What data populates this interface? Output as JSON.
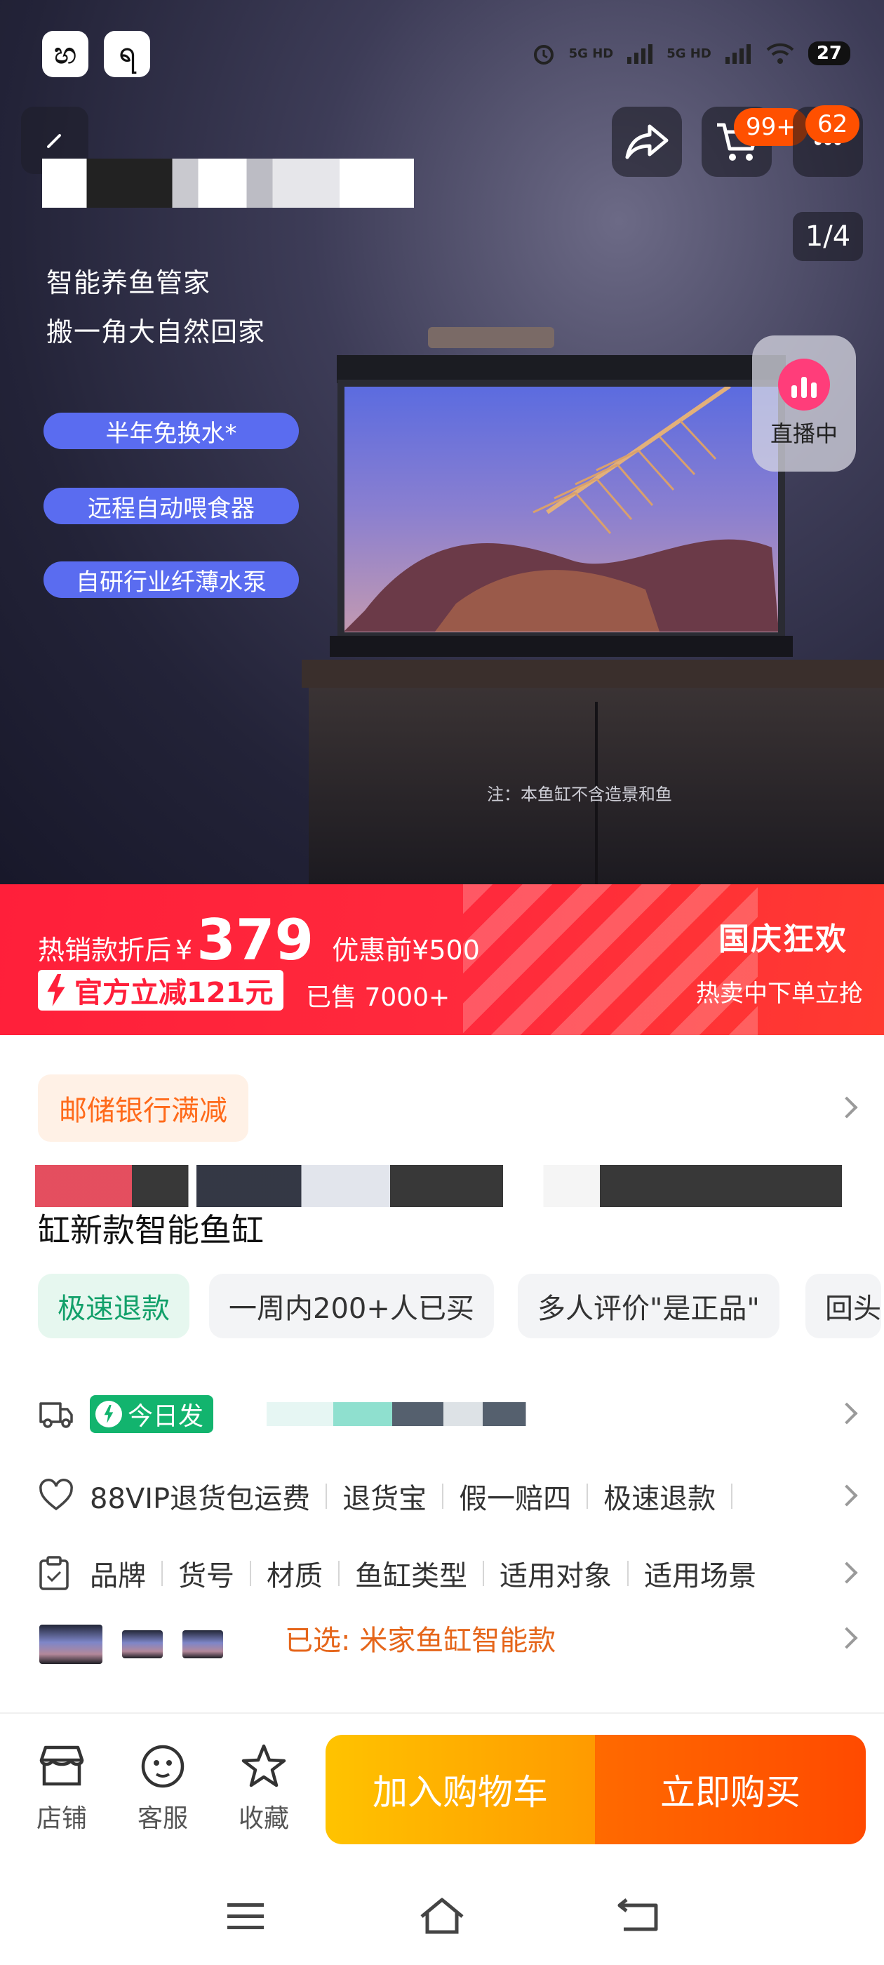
{
  "colors": {
    "accent_orange": "#ff5000",
    "promo_red": "#ff1f3a",
    "live_pink": "#ff3d7a",
    "feature_pill_blue": "#5a6cf0",
    "green": "#12a06a"
  },
  "status_bar": {
    "battery": "27",
    "signal_1": "5G HD",
    "signal_2": "5G HD"
  },
  "header": {
    "cart_badge": "99+",
    "message_badge": "62",
    "page_indicator": "1/4"
  },
  "hero": {
    "headline_1": "智能养鱼管家",
    "headline_2": "搬一角大自然回家",
    "features": [
      "半年免换水*",
      "远程自动喂食器",
      "自研行业纤薄水泵"
    ],
    "live_label": "直播中",
    "note": "注：本鱼缸不含造景和鱼"
  },
  "promo": {
    "label": "热销款折后",
    "currency": "¥",
    "price": "379",
    "before": "优惠前¥500",
    "official_off": "官方立减121元",
    "sold": "已售 7000+",
    "event_title": "国庆狂欢",
    "event_sub": "热卖中下单立抢"
  },
  "detail": {
    "bank_tag": "邮储银行满减",
    "title_tail": "缸新款智能鱼缸",
    "chips": [
      "极速退款",
      "一周内200+人已买",
      "多人评价\"是正品\"",
      "回头"
    ],
    "today_badge": "今日发",
    "services": [
      "88VIP退货包运费",
      "退货宝",
      "假一赔四",
      "极速退款"
    ],
    "params": [
      "品牌",
      "货号",
      "材质",
      "鱼缸类型",
      "适用对象",
      "适用场景"
    ],
    "selected": "已选: 米家鱼缸智能款"
  },
  "action_bar": {
    "store": "店铺",
    "service": "客服",
    "favorite": "收藏",
    "add_to_cart": "加入购物车",
    "buy_now": "立即购买"
  }
}
